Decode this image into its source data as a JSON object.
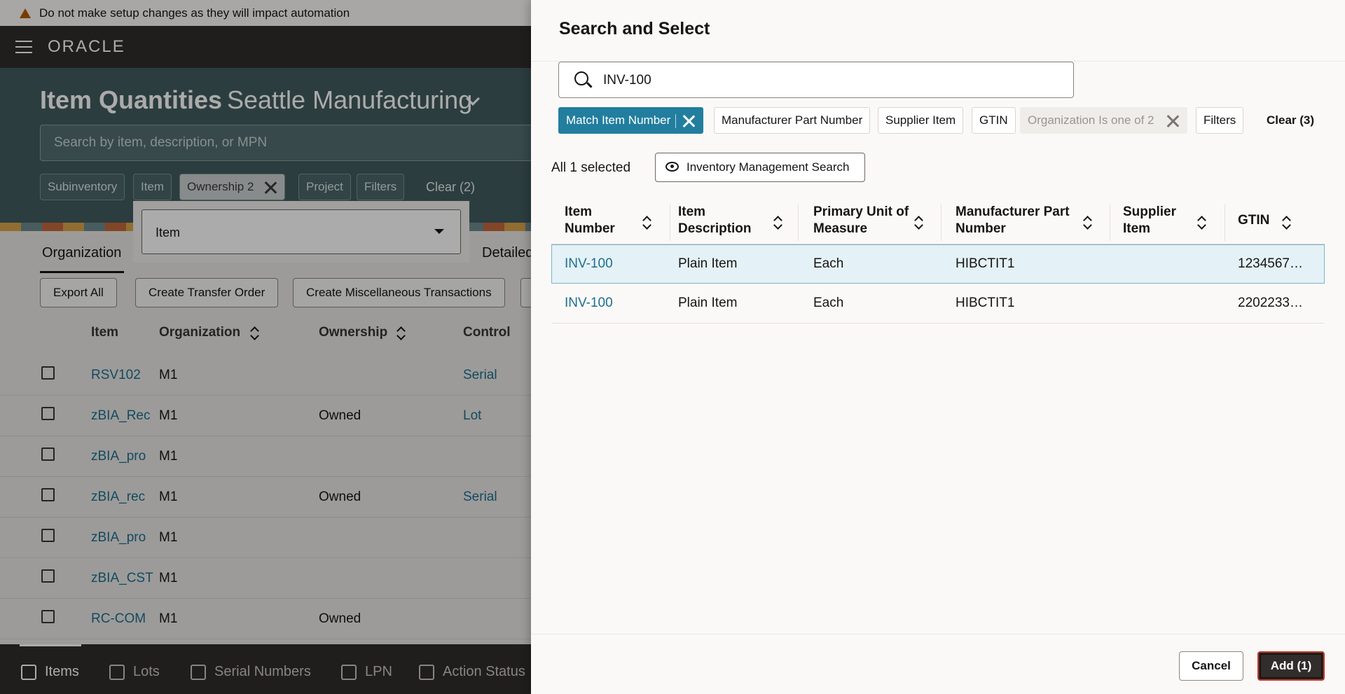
{
  "background": {
    "warning": "Do not make setup changes as they will impact automation",
    "logo": "ORACLE",
    "page_title": "Item Quantities",
    "organization": "Seattle Manufacturing",
    "search_placeholder": "Search by item, description, or MPN",
    "chips": [
      "Subinventory",
      "Item",
      "Ownership 2",
      "Project",
      "Filters"
    ],
    "clear": "Clear (2)",
    "popup_select": "Item",
    "tabs": [
      "Organization",
      "Detailed"
    ],
    "buttons": [
      "Export All",
      "Create Transfer Order",
      "Create Miscellaneous Transactions"
    ],
    "columns": [
      "Item",
      "Organization",
      "Ownership",
      "Control"
    ],
    "rows": [
      {
        "item": "RSV102",
        "org": "M1",
        "ownership": "",
        "control": "Serial"
      },
      {
        "item": "zBIA_Rec",
        "org": "M1",
        "ownership": "Owned",
        "control": "Lot"
      },
      {
        "item": "zBIA_pro",
        "org": "M1",
        "ownership": "",
        "control": ""
      },
      {
        "item": "zBIA_rec",
        "org": "M1",
        "ownership": "Owned",
        "control": "Serial"
      },
      {
        "item": "zBIA_pro",
        "org": "M1",
        "ownership": "",
        "control": ""
      },
      {
        "item": "zBIA_CST",
        "org": "M1",
        "ownership": "",
        "control": ""
      },
      {
        "item": "RC-COM",
        "org": "M1",
        "ownership": "Owned",
        "control": ""
      }
    ],
    "bottom_nav": [
      "Items",
      "Lots",
      "Serial Numbers",
      "LPN",
      "Action Status"
    ]
  },
  "drawer": {
    "title": "Search and Select",
    "search_value": "INV-100",
    "chips": {
      "match_item_number": "Match Item Number",
      "manufacturer_part_number": "Manufacturer Part Number",
      "supplier_item": "Supplier Item",
      "gtin": "GTIN",
      "organization": "Organization Is one of 2",
      "filters": "Filters"
    },
    "clear": "Clear (3)",
    "selection": "All 1 selected",
    "ims_button": "Inventory Management Search",
    "columns": {
      "item_number": "Item Number",
      "item_description": "Item Description",
      "uom": "Primary Unit of Measure",
      "mpn": "Manufacturer Part Number",
      "supplier_item": "Supplier Item",
      "gtin": "GTIN"
    },
    "rows": [
      {
        "item_number": "INV-100",
        "description": "Plain Item",
        "uom": "Each",
        "mpn": "HIBCTIT1",
        "supplier_item": "",
        "gtin": "1234567…"
      },
      {
        "item_number": "INV-100",
        "description": "Plain Item",
        "uom": "Each",
        "mpn": "HIBCTIT1",
        "supplier_item": "",
        "gtin": "2202233…"
      }
    ],
    "cancel": "Cancel",
    "add": "Add (1)"
  }
}
